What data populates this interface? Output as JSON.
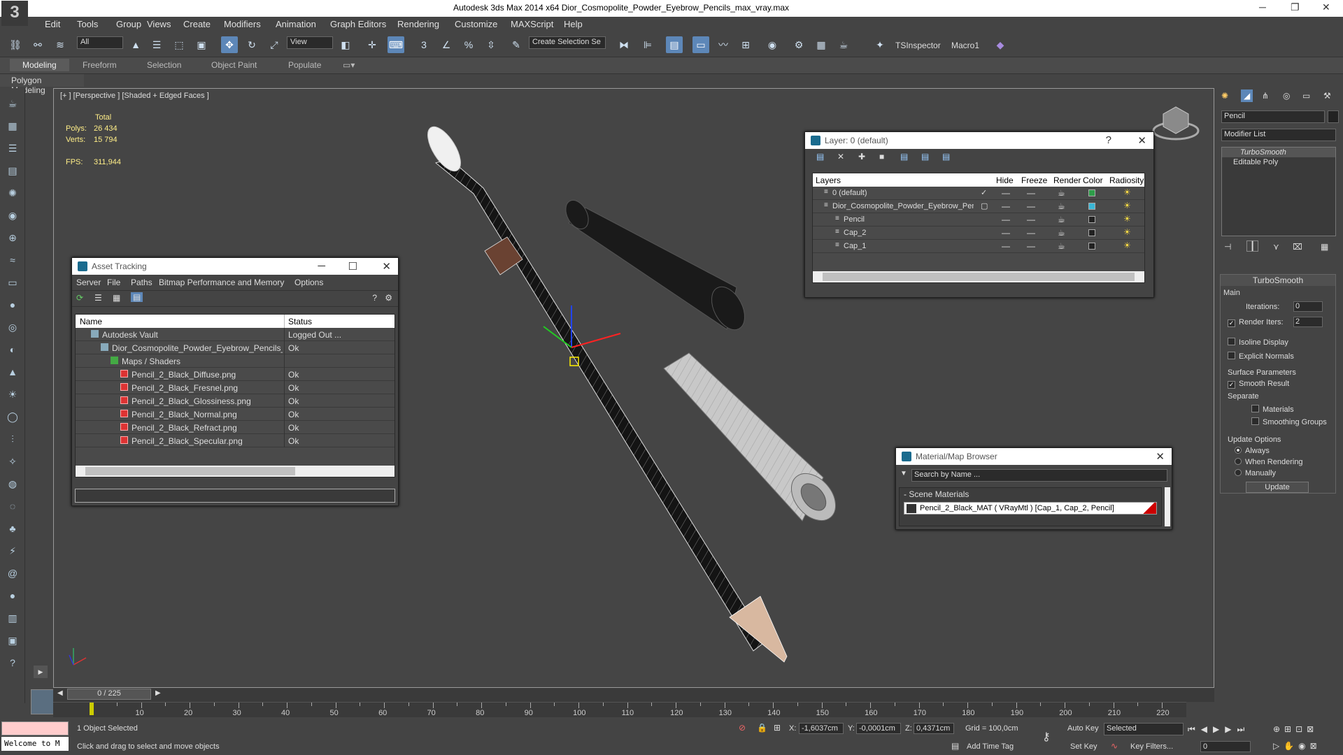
{
  "window": {
    "title": "Autodesk 3ds Max  2014 x64     Dior_Cosmopolite_Powder_Eyebrow_Pencils_max_vray.max"
  },
  "menu": [
    "Edit",
    "Tools",
    "Group",
    "Views",
    "Create",
    "Modifiers",
    "Animation",
    "Graph Editors",
    "Rendering",
    "Customize",
    "MAXScript",
    "Help"
  ],
  "toolbar": {
    "filter": "All",
    "refcoord": "View",
    "selset": "Create Selection Se",
    "tsinspector": "TSInspector",
    "macro": "Macro1"
  },
  "ribbon": {
    "tabs": [
      "Modeling",
      "Freeform",
      "Selection",
      "Object Paint",
      "Populate"
    ],
    "sub": "Polygon Modeling"
  },
  "viewport": {
    "label": "[+ ] [Perspective ] [Shaded + Edged Faces ]",
    "stats": {
      "total": "Total",
      "polys_k": "Polys:",
      "polys": "26 434",
      "verts_k": "Verts:",
      "verts": "15 794",
      "fps_k": "FPS:",
      "fps": "311,944"
    }
  },
  "asset_tracking": {
    "title": "Asset Tracking",
    "menu": [
      "Server",
      "File",
      "Paths",
      "Bitmap Performance and Memory",
      "Options"
    ],
    "col_name": "Name",
    "col_status": "Status",
    "rows": [
      {
        "name": "Autodesk Vault",
        "status": "Logged Out ...",
        "indent": 1,
        "icon": "vault-icon"
      },
      {
        "name": "Dior_Cosmopolite_Powder_Eyebrow_Pencils_max_vray....",
        "status": "Ok",
        "indent": 2,
        "icon": "max-file-icon"
      },
      {
        "name": "Maps / Shaders",
        "status": "",
        "indent": 3,
        "icon": "maps-icon"
      },
      {
        "name": "Pencil_2_Black_Diffuse.png",
        "status": "Ok",
        "indent": 4,
        "icon": "bitmap-icon"
      },
      {
        "name": "Pencil_2_Black_Fresnel.png",
        "status": "Ok",
        "indent": 4,
        "icon": "bitmap-icon"
      },
      {
        "name": "Pencil_2_Black_Glossiness.png",
        "status": "Ok",
        "indent": 4,
        "icon": "bitmap-icon"
      },
      {
        "name": "Pencil_2_Black_Normal.png",
        "status": "Ok",
        "indent": 4,
        "icon": "bitmap-icon"
      },
      {
        "name": "Pencil_2_Black_Refract.png",
        "status": "Ok",
        "indent": 4,
        "icon": "bitmap-icon"
      },
      {
        "name": "Pencil_2_Black_Specular.png",
        "status": "Ok",
        "indent": 4,
        "icon": "bitmap-icon"
      }
    ]
  },
  "layer": {
    "title": "Layer: 0 (default)",
    "help": "?",
    "cols": [
      "Layers",
      "Hide",
      "Freeze",
      "Render",
      "Color",
      "Radiosity"
    ],
    "rows": [
      {
        "name": "0 (default)",
        "indent": 1,
        "color": "#2e9e4a",
        "check": "✓"
      },
      {
        "name": "Dior_Cosmopolite_Powder_Eyebrow_Penc",
        "indent": 1,
        "color": "#3ab6d6",
        "check": "▢"
      },
      {
        "name": "Pencil",
        "indent": 2,
        "color": "#222222",
        "check": ""
      },
      {
        "name": "Cap_2",
        "indent": 2,
        "color": "#222222",
        "check": ""
      },
      {
        "name": "Cap_1",
        "indent": 2,
        "color": "#222222",
        "check": ""
      }
    ]
  },
  "material": {
    "title": "Material/Map Browser",
    "search": "Search by Name ...",
    "group": "- Scene Materials",
    "item": "Pencil_2_Black_MAT  ( VRayMtl )  [Cap_1, Cap_2, Pencil]"
  },
  "command": {
    "object_name": "Pencil",
    "modlist": "Modifier List",
    "stack": [
      "TurboSmooth",
      "Editable Poly"
    ],
    "rollout": "TurboSmooth",
    "main": "Main",
    "iterations_k": "Iterations:",
    "iterations": "0",
    "render_iters_k": "Render Iters:",
    "render_iters": "2",
    "isoline": "Isoline Display",
    "explicit": "Explicit Normals",
    "surface": "Surface Parameters",
    "smooth": "Smooth Result",
    "separate": "Separate",
    "materials": "Materials",
    "smoothing": "Smoothing Groups",
    "update_opts": "Update Options",
    "always": "Always",
    "when_rendering": "When Rendering",
    "manually": "Manually",
    "update": "Update"
  },
  "timeline": {
    "frame": "0 / 225",
    "ticks": [
      "10",
      "20",
      "30",
      "40",
      "50",
      "60",
      "70",
      "80",
      "90",
      "100",
      "110",
      "120",
      "130",
      "140",
      "150",
      "160",
      "170",
      "180",
      "190",
      "200",
      "210",
      "220"
    ]
  },
  "status": {
    "selected": "1 Object Selected",
    "prompt": "Click and drag to select and move objects",
    "welcome": "Welcome to M",
    "x_k": "X:",
    "x": "-1,6037cm",
    "y_k": "Y:",
    "y": "-0,0001cm",
    "z_k": "Z:",
    "z": "0,4371cm",
    "grid": "Grid = 100,0cm",
    "addtime": "Add Time Tag",
    "autokey": "Auto Key",
    "setkey": "Set Key",
    "selmode": "Selected",
    "keyfilters": "Key Filters...",
    "frame_field": "0"
  }
}
